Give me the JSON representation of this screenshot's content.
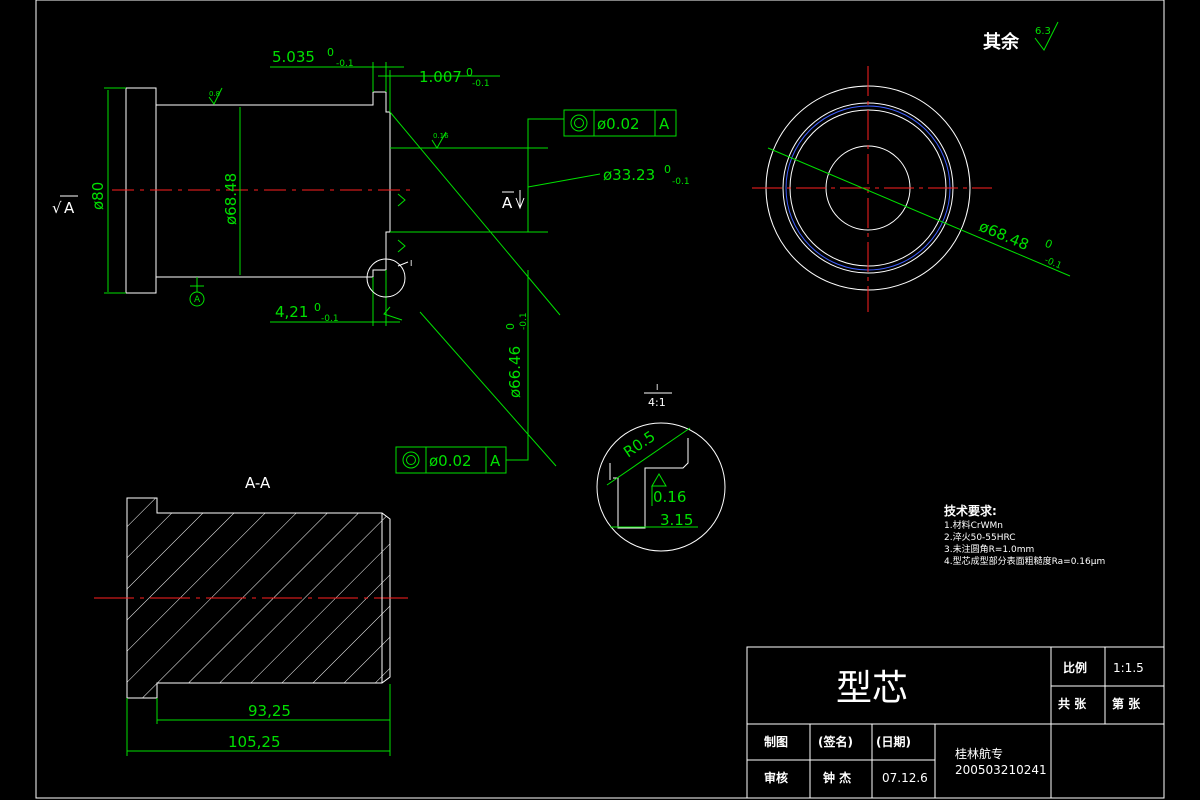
{
  "drawing": {
    "other_roughness": {
      "label": "其余",
      "value": "6.3"
    },
    "main_view": {
      "dim_step_len": "5.035",
      "dim_step_len_tol": "0",
      "dim_step_len_tol_low": "-0.1",
      "dim_small_len": "1.007",
      "dim_small_len_tol": "0",
      "dim_small_len_tol_low": "-0.1",
      "dim_phi80": "ø80",
      "dim_phi6848": "ø68.48",
      "dim_4_21": "4,21",
      "dim_4_21_tol": "0",
      "dim_4_21_tol_low": "-0.1",
      "dim_phi3323": "ø33.23",
      "dim_phi3323_tol": "0",
      "dim_phi3323_tol_low": "-0.1",
      "dim_phi6646": "ø66.46",
      "dim_phi6646_tol": "0",
      "dim_phi6646_tol_low": "-0.1",
      "datum_letter": "A",
      "datum_ref": "A",
      "section_mark": "A",
      "detail_mark": "I",
      "tol_value": "ø0.02",
      "tol_datum": "A",
      "rough_08": "0.8",
      "rough_016": "0.16"
    },
    "end_view": {
      "dim": "ø68.48",
      "dim_tol": "0",
      "dim_tol_low": "-0.1"
    },
    "detail": {
      "label": "I",
      "scale": "4:1",
      "radius": "R0.5",
      "roughness": "0.16",
      "dim": "3.15"
    },
    "section": {
      "title": "A-A",
      "dim_9325": "93,25",
      "dim_10525": "105,25"
    },
    "tech_req": {
      "title": "技术要求:",
      "items": [
        "1.材料CrWMn",
        "2.淬火50-55HRC",
        "3.未注圆角R=1.0mm",
        "4.型芯成型部分表面粗糙度Ra=0.16μm"
      ]
    }
  },
  "title_block": {
    "part_name": "型芯",
    "scale_label": "比例",
    "scale_value": "1:1.5",
    "sheets_total": "共  张",
    "sheet_no": "第  张",
    "drawn_label": "制图",
    "sign_label": "(签名)",
    "date_label": "(日期)",
    "checked_label": "审核",
    "designer": "钟 杰",
    "date": "07.12.6",
    "school": "桂林航专",
    "student_id": "200503210241"
  },
  "colors": {
    "background": "#000000",
    "outline": "#ffffff",
    "dimension": "#00e000",
    "centerline": "#ff2020",
    "thread": "#4060ff"
  }
}
